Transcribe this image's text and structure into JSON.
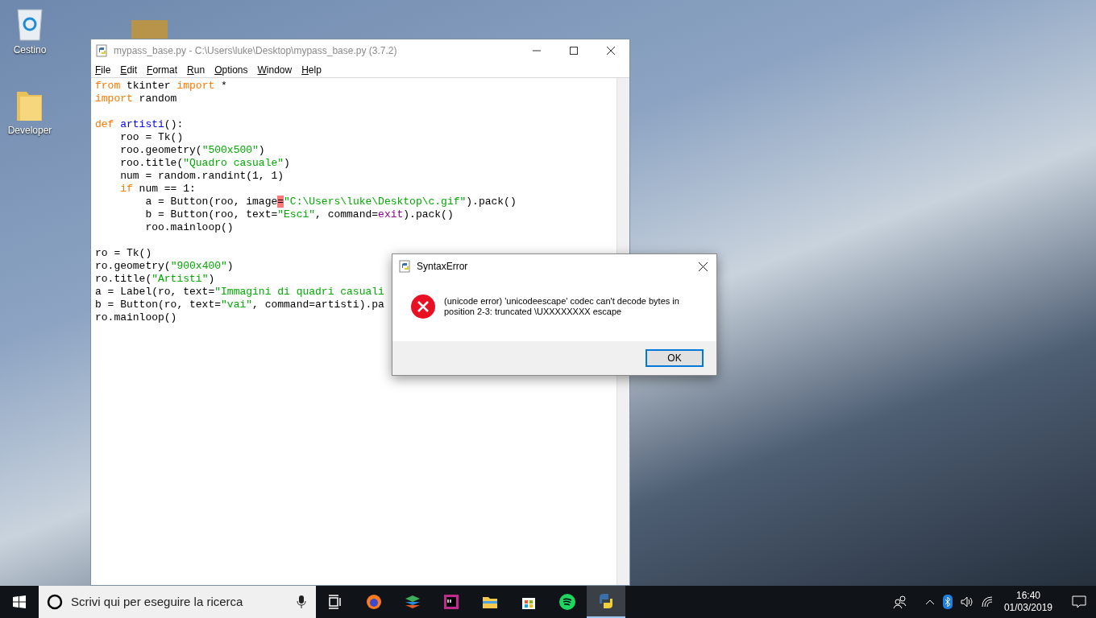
{
  "desktop_icons": [
    {
      "kind": "recycle-bin",
      "label": "Cestino"
    },
    {
      "kind": "folder",
      "label": "Developer"
    },
    {
      "kind": "picture"
    }
  ],
  "editor": {
    "title": "mypass_base.py - C:\\Users\\luke\\Desktop\\mypass_base.py (3.7.2)",
    "menu": [
      "File",
      "Edit",
      "Format",
      "Run",
      "Options",
      "Window",
      "Help"
    ],
    "lines": [
      [
        {
          "kind": "keyword",
          "text": "from"
        },
        {
          "kind": "plain",
          "text": " tkinter "
        },
        {
          "kind": "keyword",
          "text": "import"
        },
        {
          "kind": "plain",
          "text": " *"
        }
      ],
      [
        {
          "kind": "keyword",
          "text": "import"
        },
        {
          "kind": "plain",
          "text": " random"
        }
      ],
      [
        {
          "kind": "blank"
        }
      ],
      [
        {
          "kind": "keyword",
          "text": "def "
        },
        {
          "kind": "definition",
          "text": "artisti"
        },
        {
          "kind": "plain",
          "text": "():"
        }
      ],
      [
        {
          "kind": "plain",
          "text": "    roo = Tk()"
        }
      ],
      [
        {
          "kind": "plain",
          "text": "    roo.geometry("
        },
        {
          "kind": "string",
          "text": "\"500x500\""
        },
        {
          "kind": "plain",
          "text": ")"
        }
      ],
      [
        {
          "kind": "plain",
          "text": "    roo.title("
        },
        {
          "kind": "string",
          "text": "\"Quadro casuale\""
        },
        {
          "kind": "plain",
          "text": ")"
        }
      ],
      [
        {
          "kind": "plain",
          "text": "    num = random.randint(1, 1)"
        }
      ],
      [
        {
          "kind": "keyword",
          "text": "    if"
        },
        {
          "kind": "plain",
          "text": " num == 1:"
        }
      ],
      [
        {
          "kind": "plain",
          "text": "        a = Button(roo, image"
        },
        {
          "kind": "error",
          "text": "="
        },
        {
          "kind": "string",
          "text": "\"C:\\Users\\luke\\Desktop\\c.gif\""
        },
        {
          "kind": "plain",
          "text": ").pack()"
        }
      ],
      [
        {
          "kind": "plain",
          "text": "        b = Button(roo, text="
        },
        {
          "kind": "string",
          "text": "\"Esci\""
        },
        {
          "kind": "plain",
          "text": ", command="
        },
        {
          "kind": "builtin",
          "text": "exit"
        },
        {
          "kind": "plain",
          "text": ").pack()"
        }
      ],
      [
        {
          "kind": "plain",
          "text": "        roo.mainloop()"
        }
      ],
      [
        {
          "kind": "blank"
        }
      ],
      [
        {
          "kind": "plain",
          "text": "ro = Tk()"
        }
      ],
      [
        {
          "kind": "plain",
          "text": "ro.geometry("
        },
        {
          "kind": "string",
          "text": "\"900x400\""
        },
        {
          "kind": "plain",
          "text": ")"
        }
      ],
      [
        {
          "kind": "plain",
          "text": "ro.title("
        },
        {
          "kind": "string",
          "text": "\"Artisti\""
        },
        {
          "kind": "plain",
          "text": ")"
        }
      ],
      [
        {
          "kind": "plain",
          "text": "a = Label(ro, text="
        },
        {
          "kind": "string",
          "text": "\"Immagini di quadri casuali"
        }
      ],
      [
        {
          "kind": "plain",
          "text": "b = Button(ro, text="
        },
        {
          "kind": "string",
          "text": "\"vai\""
        },
        {
          "kind": "plain",
          "text": ", command=artisti).pa"
        }
      ],
      [
        {
          "kind": "plain",
          "text": "ro.mainloop()"
        }
      ]
    ]
  },
  "dialog": {
    "title": "SyntaxError",
    "message": "(unicode error) 'unicodeescape' codec can't decode bytes in position 2-3: truncated \\UXXXXXXXX escape",
    "button": "OK"
  },
  "taskbar": {
    "search": {
      "placeholder": "Scrivi qui per eseguire la ricerca"
    },
    "apps": [
      {
        "kind": "task-view",
        "selected": false
      },
      {
        "kind": "firefox",
        "selected": false
      },
      {
        "kind": "layers",
        "selected": false
      },
      {
        "kind": "ide",
        "selected": false
      },
      {
        "kind": "explorer",
        "selected": false
      },
      {
        "kind": "store",
        "selected": false
      },
      {
        "kind": "spotify",
        "selected": false
      },
      {
        "kind": "python",
        "selected": true
      }
    ],
    "time": "16:40",
    "date": "01/03/2019"
  }
}
